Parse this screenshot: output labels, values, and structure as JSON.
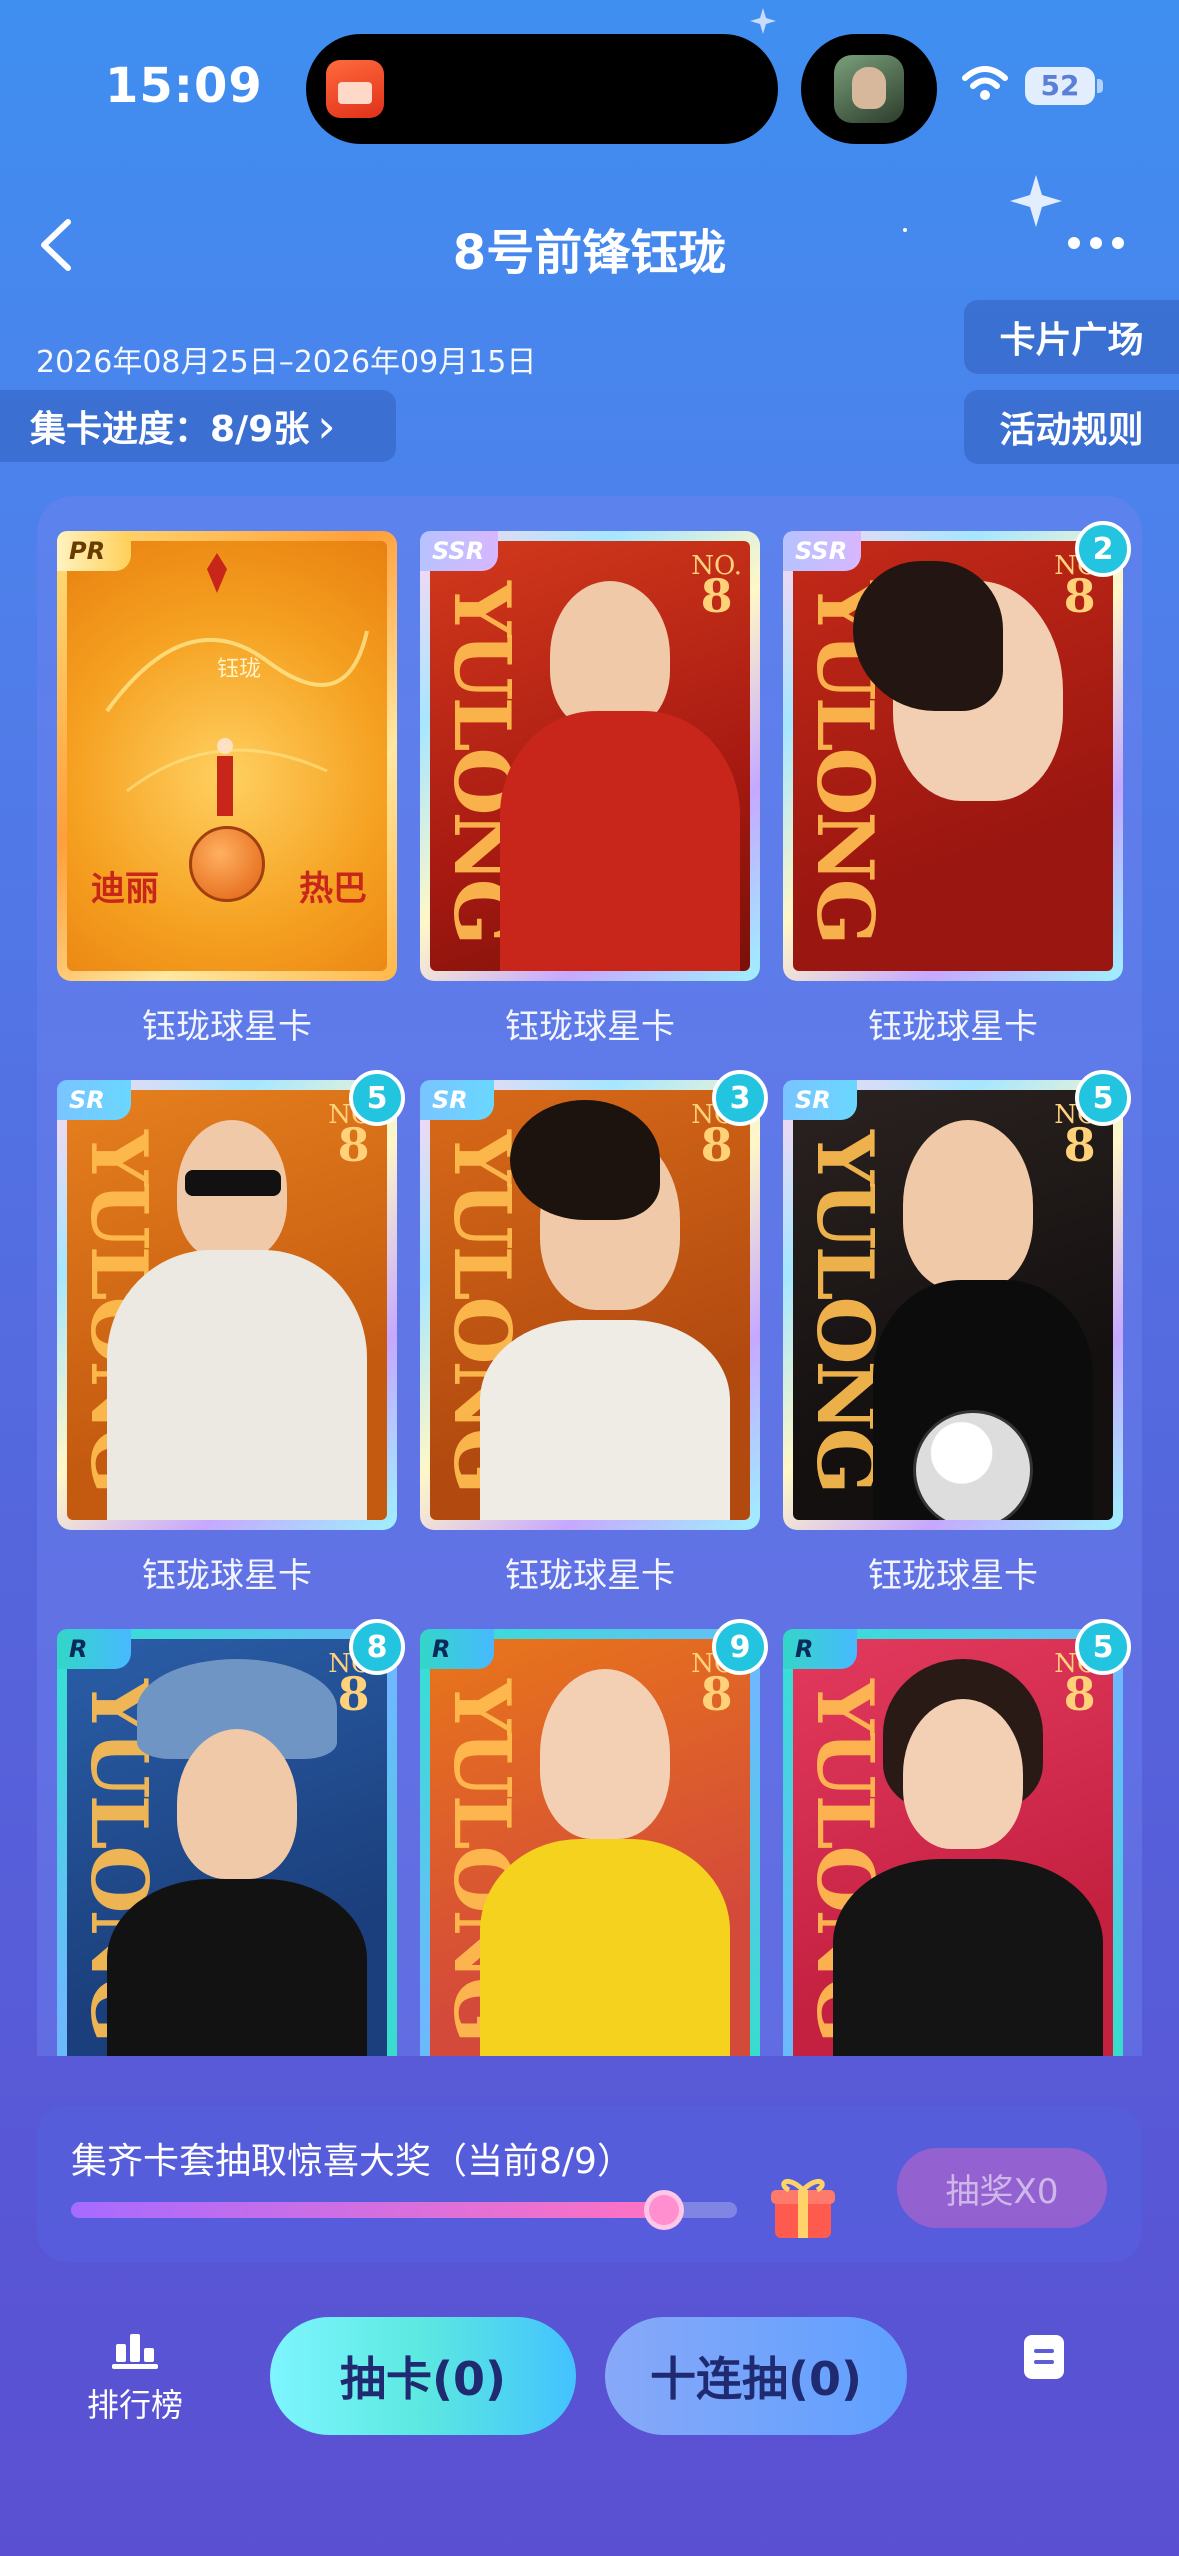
{
  "status": {
    "time": "15:09",
    "battery": "52"
  },
  "header": {
    "title": "8号前锋钰珑",
    "date_range": "2026年08月25日–2026年09月15日"
  },
  "side_buttons": {
    "card_plaza": "卡片广场",
    "rules": "活动规则"
  },
  "progress": {
    "label": "集卡进度：8/9张",
    "arrow": "›"
  },
  "cards": [
    {
      "name": "钰珑球星卡",
      "rarity": "PR",
      "count": ""
    },
    {
      "name": "钰珑球星卡",
      "rarity": "SSR",
      "count": ""
    },
    {
      "name": "钰珑球星卡",
      "rarity": "SSR",
      "count": "2"
    },
    {
      "name": "钰珑球星卡",
      "rarity": "SR",
      "count": "5"
    },
    {
      "name": "钰珑球星卡",
      "rarity": "SR",
      "count": "3"
    },
    {
      "name": "钰珑球星卡",
      "rarity": "SR",
      "count": "5"
    },
    {
      "name": "",
      "rarity": "R",
      "count": "8"
    },
    {
      "name": "",
      "rarity": "R",
      "count": "9"
    },
    {
      "name": "",
      "rarity": "R",
      "count": "5"
    }
  ],
  "card_art": {
    "vertical_text": "YULONG",
    "number_label": "NO.",
    "number": "8",
    "name_vertical": "钰珑",
    "pr_left": "迪丽",
    "pr_right": "热巴",
    "pr_name": "钰珑"
  },
  "prize": {
    "text": "集齐卡套抽取惊喜大奖（当前8/9）",
    "progress": 0.89,
    "button": "抽奖X0"
  },
  "bottom": {
    "rank": "排行榜",
    "draw_one": "抽卡(0)",
    "draw_ten": "十连抽(0)"
  }
}
